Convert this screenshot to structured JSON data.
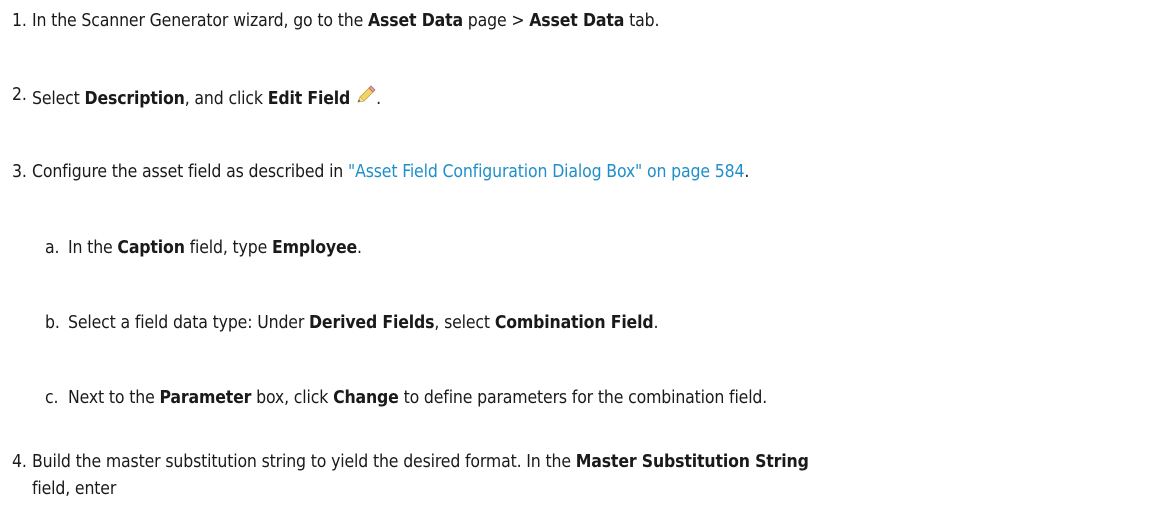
{
  "steps": [
    {
      "number": "1.",
      "parts": [
        "In the Scanner Generator wizard, go to the ",
        "Asset Data",
        " page > ",
        "Asset Data",
        " tab."
      ]
    },
    {
      "number": "2.",
      "parts": [
        "Select ",
        "Description",
        ", and click ",
        "Edit Field",
        "."
      ],
      "icon": "pencil-icon"
    },
    {
      "number": "3.",
      "parts": [
        "Configure the asset field as described in ",
        "\"Asset Field Configuration Dialog Box\" on page 584",
        "."
      ]
    },
    {
      "number": "a.",
      "parts": [
        "In the ",
        "Caption",
        " field, type ",
        "Employee",
        "."
      ]
    },
    {
      "number": "b.",
      "parts": [
        "Select a field data type: Under ",
        "Derived Fields",
        ", select ",
        "Combination Field",
        "."
      ]
    },
    {
      "number": "c.",
      "parts": [
        "Next to the ",
        "Parameter",
        " box, click ",
        "Change",
        " to define parameters for the combination field."
      ]
    },
    {
      "number": "4.",
      "parts": [
        "Build the master substitution string to yield the desired format. In the ",
        "Master Substitution String"
      ],
      "continuation": "field, enter"
    }
  ],
  "link_color": "#1f8fc9"
}
